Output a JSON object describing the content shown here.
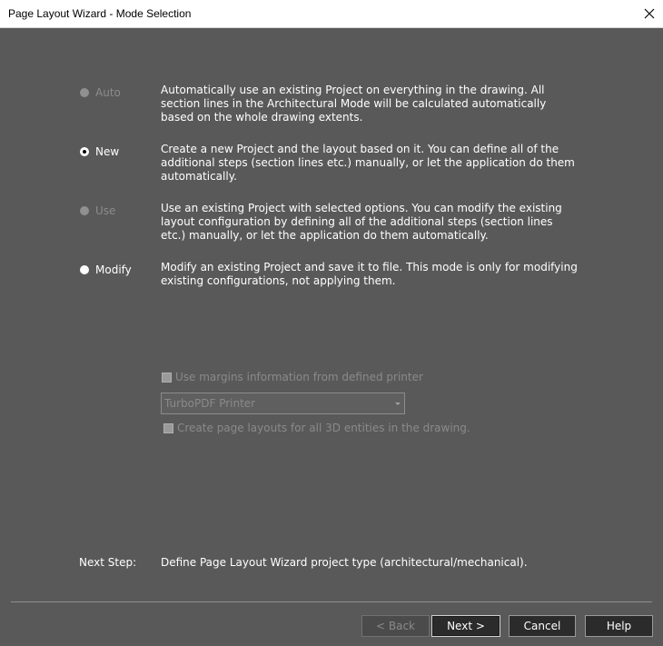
{
  "window": {
    "title": "Page Layout Wizard - Mode Selection",
    "close_glyph": "✕"
  },
  "modes": [
    {
      "label": "Auto",
      "enabled": false,
      "checked": false,
      "description": "Automatically use an existing Project on everything in the drawing. All section lines in the Architectural Mode will be calculated automatically based on the whole drawing extents."
    },
    {
      "label": "New",
      "enabled": true,
      "checked": true,
      "description": "Create a new Project and the layout based on it. You can define all of the additional steps (section lines etc.) manually, or let the application do them automatically."
    },
    {
      "label": "Use",
      "enabled": false,
      "checked": false,
      "description": "Use an existing Project with selected options. You can modify the existing layout configuration by defining all of the additional steps (section lines etc.) manually, or let the application do them automatically."
    },
    {
      "label": "Modify",
      "enabled": true,
      "checked": false,
      "description": "Modify an existing Project and save it to file. This mode is only for modifying existing configurations, not applying them."
    }
  ],
  "options": {
    "use_margins_label": "Use margins information from defined printer",
    "printer_selected": "TurboPDF Printer",
    "create_layouts_label": "Create page layouts for all 3D entities in the drawing."
  },
  "next_step": {
    "label": "Next Step:",
    "text": "Define Page Layout Wizard project type (architectural/mechanical)."
  },
  "buttons": {
    "back": "< Back",
    "next": "Next >",
    "cancel": "Cancel",
    "help": "Help"
  },
  "colors": {
    "background": "#595959",
    "button_bg": "#2b2b2b",
    "titlebar": "#ffffff"
  }
}
